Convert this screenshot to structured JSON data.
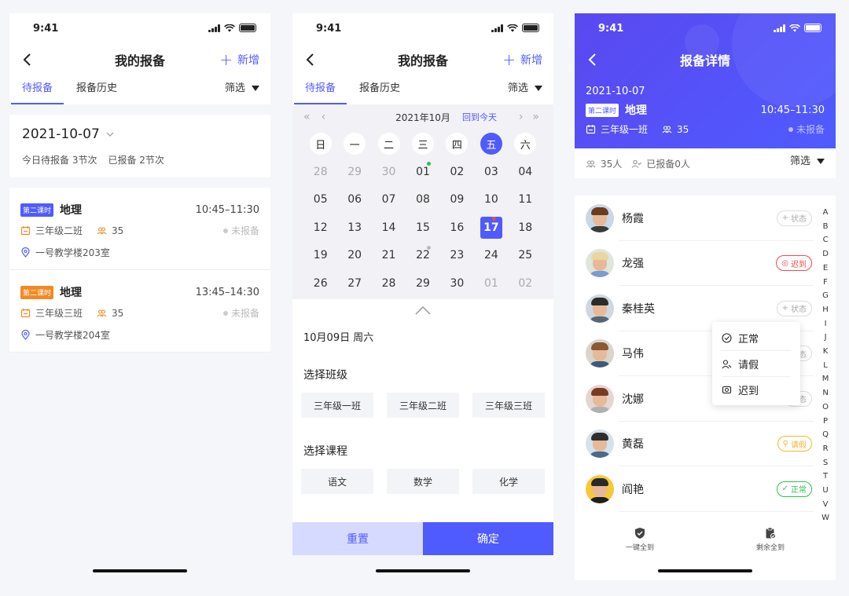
{
  "status_time": "9:41",
  "colors": {
    "accent": "#4f5bff",
    "late": "#f04a4a",
    "leave": "#f5b531",
    "normal": "#2fbf4b"
  },
  "screen1": {
    "title": "我的报备",
    "add_label": "新增",
    "tabs": [
      "待报备",
      "报备历史"
    ],
    "filter_label": "筛选",
    "date": "2021-10-07",
    "summary_pending": "今日待报备 3节次",
    "summary_done": "已报备 2节次",
    "lessons": [
      {
        "tag": "第二课时",
        "subject": "地理",
        "time": "10:45–11:30",
        "class": "三年级二班",
        "count": "35",
        "status": "未报备",
        "room": "一号教学楼203室"
      },
      {
        "tag": "第二课时",
        "subject": "地理",
        "time": "13:45–14:30",
        "class": "三年级三班",
        "count": "35",
        "status": "未报备",
        "room": "一号教学楼204室"
      }
    ]
  },
  "screen2": {
    "title": "我的报备",
    "add_label": "新增",
    "tabs": [
      "待报备",
      "报备历史"
    ],
    "filter_label": "筛选",
    "month": "2021年10月",
    "back_today": "回到今天",
    "weekdays": [
      "日",
      "一",
      "二",
      "三",
      "四",
      "五",
      "六"
    ],
    "days": [
      "28",
      "29",
      "30",
      "01",
      "02",
      "03",
      "04",
      "05",
      "06",
      "07",
      "08",
      "09",
      "10",
      "11",
      "12",
      "13",
      "14",
      "15",
      "16",
      "17",
      "18",
      "19",
      "20",
      "21",
      "22",
      "23",
      "24",
      "25",
      "26",
      "27",
      "28",
      "29",
      "30",
      "01",
      "02"
    ],
    "selected_date": "10月09日  周六",
    "class_section": "选择班级",
    "classes": [
      "三年级一班",
      "三年级二班",
      "三年级三班"
    ],
    "course_section": "选择课程",
    "courses": [
      "语文",
      "数学",
      "化学"
    ],
    "reset_label": "重置",
    "confirm_label": "确定"
  },
  "screen3": {
    "title": "报备详情",
    "date": "2021-10-07",
    "tag": "第二课时",
    "subject": "地理",
    "time": "10:45–11:30",
    "class": "三年级一班",
    "count": "35",
    "status": "未报备",
    "stat_total": "35人",
    "stat_reported": "已报备0人",
    "filter_label": "筛选",
    "students": [
      {
        "name": "杨霞",
        "badge": "状态"
      },
      {
        "name": "龙强",
        "badge": "迟到"
      },
      {
        "name": "秦桂英",
        "badge": "状态"
      },
      {
        "name": "马伟",
        "badge": "状态"
      },
      {
        "name": "沈娜",
        "badge": "状态"
      },
      {
        "name": "黄磊",
        "badge": "请假"
      },
      {
        "name": "阎艳",
        "badge": "正常"
      }
    ],
    "alphabet": [
      "A",
      "B",
      "C",
      "D",
      "E",
      "F",
      "G",
      "H",
      "I",
      "J",
      "K",
      "L",
      "M",
      "N",
      "O",
      "P",
      "Q",
      "R",
      "S",
      "T",
      "U",
      "V",
      "W"
    ],
    "popup_options": [
      "正常",
      "请假",
      "迟到"
    ],
    "bottom_actions": [
      "一键全到",
      "剩余全到"
    ]
  }
}
